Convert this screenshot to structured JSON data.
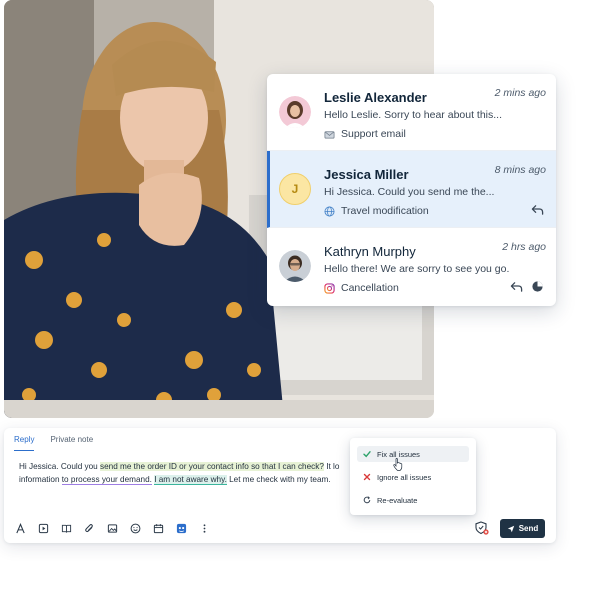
{
  "conversations": [
    {
      "name": "Leslie Alexander",
      "time": "2 mins ago",
      "preview": "Hello Leslie. Sorry to hear about this...",
      "source": "Support email",
      "source_icon": "email-icon",
      "avatar": "photo",
      "active": false
    },
    {
      "name": "Jessica Miller",
      "time": "8 mins ago",
      "preview": "Hi Jessica. Could you send me the...",
      "source": "Travel modification",
      "source_icon": "globe-icon",
      "avatar_initial": "J",
      "active": true
    },
    {
      "name": "Kathryn Murphy",
      "time": "2 hrs ago",
      "preview": "Hello there! We are sorry to see you go.",
      "source": "Cancellation",
      "source_icon": "instagram-icon",
      "avatar": "photo",
      "active": false
    }
  ],
  "editor": {
    "tabs": [
      "Reply",
      "Private note"
    ],
    "active_tab": "Reply",
    "line1_a": "Hi Jessica. Could you ",
    "line1_hl": "send me the order ID or your contact info so that I can check?",
    "line1_b": " It lo",
    "line2_a": "information ",
    "line2_hl1": "to process your demand.",
    "line2_sp": " ",
    "line2_hl2": "I am not aware why.",
    "line2_b": " Let me check with my team.",
    "send_label": "Send"
  },
  "issues_menu": {
    "items": [
      "Fix all issues",
      "Ignore all issues",
      "Re-evaluate"
    ]
  },
  "colors": {
    "accent": "#2c6ecb",
    "active_row_bg": "#e6f0fb",
    "send_button_bg": "#1f3244",
    "fix_check": "#2ea36b",
    "ignore_x": "#d93a3a",
    "grammar_green_bg": "#e7f2d5",
    "grammar_purple": "#9e7ee3",
    "grammar_teal": "#3bb59d"
  },
  "toolbar_icons": [
    "text-format-icon",
    "insert-media-icon",
    "knowledge-base-icon",
    "attachment-icon",
    "image-icon",
    "emoji-icon",
    "calendar-icon",
    "ai-assist-icon",
    "more-options-icon"
  ]
}
